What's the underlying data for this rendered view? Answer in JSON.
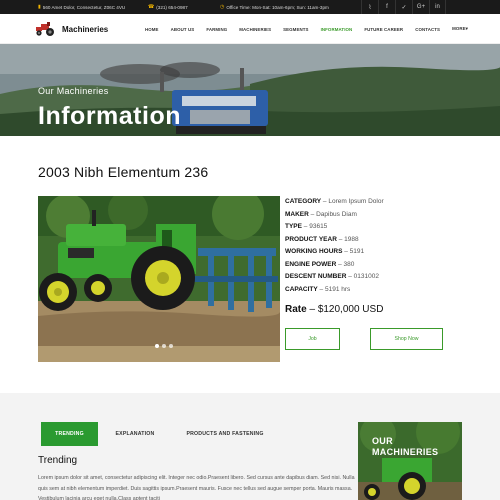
{
  "topbar": {
    "address": "560 Amet Dolor, Consectetur, Z06C 4VU",
    "phone": "(321) 654-0987",
    "hours": "Office Time: Mon-Sat: 10am-6pm; Sun: 11am-3pm"
  },
  "social_icons": [
    "rss-icon",
    "facebook-icon",
    "twitter-icon",
    "google-plus-icon",
    "linkedin-icon"
  ],
  "social_glyphs": [
    "⌇",
    "f",
    "✓",
    "G+",
    "in"
  ],
  "brand": {
    "name": "Machineries"
  },
  "nav": {
    "items": [
      "HOME",
      "ABOUT US",
      "FARMING",
      "MACHINERIES",
      "SEGMENTS",
      "INFORMATION",
      "FUTURE CAREER",
      "CONTACTS",
      "MORE"
    ],
    "active": "INFORMATION"
  },
  "banner": {
    "subtitle": "Our Machineries",
    "title": "Information"
  },
  "product": {
    "title": "2003 Nibh Elementum 236",
    "specs": [
      {
        "label": "CATEGORY",
        "value": "Lorem Ipsum Dolor"
      },
      {
        "label": "MAKER",
        "value": "Dapibus Diam"
      },
      {
        "label": "TYPE",
        "value": "93615"
      },
      {
        "label": "PRODUCT YEAR",
        "value": "1988"
      },
      {
        "label": "WORKING HOURS",
        "value": "5191"
      },
      {
        "label": "ENGINE POWER",
        "value": "380"
      },
      {
        "label": "DESCENT NUMBER",
        "value": "0131002"
      },
      {
        "label": "CAPACITY",
        "value": "5191 hrs"
      }
    ],
    "rate_label": "Rate",
    "rate_value": "$120,000 USD",
    "job_button": "Job",
    "shop_button": "Shop Now"
  },
  "tabs": [
    "TRENDING",
    "EXPLANATION",
    "PRODUCTS AND FASTENING"
  ],
  "trending": {
    "heading": "Trending",
    "text": "Lorem ipsum dolor sit amet, consectetur adipiscing elit. Integer nec odio.Praesent libero. Sed cursus ante dapibus diam. Sed nisi. Nulla quis sem at nibh elementum imperdiet. Duis sagittis ipsum.Praesent mauris. Fusce nec tellus sed augue semper porta. Mauris massa. Vestibulum lacinia arcu eget nulla.Class aptent taciti"
  },
  "side_card": {
    "line1": "OUR",
    "line2": "MACHINERIES"
  },
  "colors": {
    "accent": "#3a9a2a",
    "topbar": "#1a1a1a",
    "icon_yellow": "#f0b400"
  }
}
